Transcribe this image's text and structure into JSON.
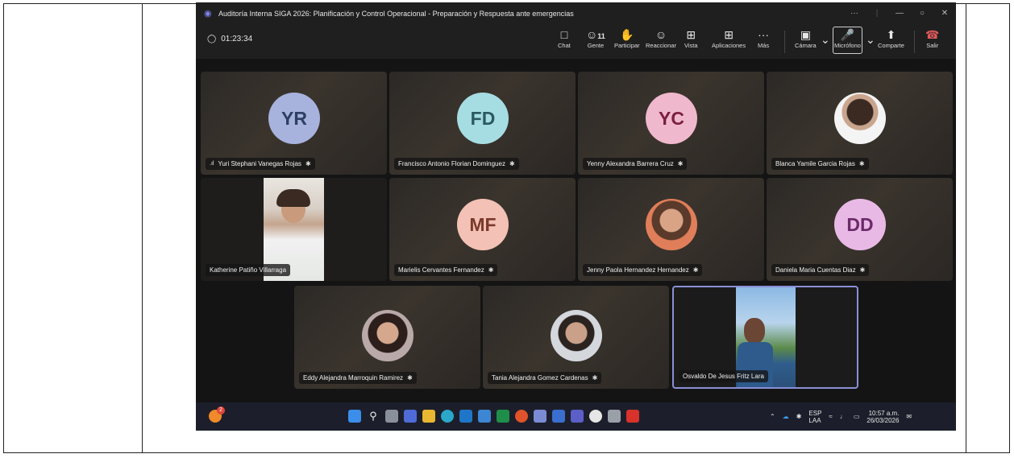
{
  "window": {
    "title": "Auditoría Interna SIGA 2026: Planificación y Control Operacional - Preparación y Respuesta ante emergencias"
  },
  "meeting": {
    "timer": "01:23:34"
  },
  "toolbar": {
    "chat": "Chat",
    "people": "Gente",
    "people_count": "11",
    "raise": "Participar",
    "react": "Reaccionar",
    "view": "Vista",
    "apps": "Aplicaciones",
    "more": "Más",
    "camera": "Cámara",
    "mic": "Micrófono",
    "share": "Comparte",
    "leave": "Salir"
  },
  "participants": [
    {
      "name": "Yuri Stephani Vanegas Rojas",
      "initials": "YR",
      "color": "#2d3e63",
      "bg": "#a7b2dd"
    },
    {
      "name": "Francisco Antonio Florian Dominguez",
      "initials": "FD",
      "color": "#2a5a60",
      "bg": "#a6dde2"
    },
    {
      "name": "Yenny Alexandra Barrera Cruz",
      "initials": "YC",
      "color": "#7a1f3d",
      "bg": "#f0b8cc"
    },
    {
      "name": "Blanca Yamile Garcia Rojas"
    },
    {
      "name": "Katherine Patiño Villarraga"
    },
    {
      "name": "Marielis Cervantes Fernandez",
      "initials": "MF",
      "color": "#7a3a2c",
      "bg": "#f3c1b5"
    },
    {
      "name": "Jenny Paola Hernandez Hernandez"
    },
    {
      "name": "Daniela Maria Cuentas Diaz",
      "initials": "DD",
      "color": "#6b2a6a",
      "bg": "#e9b9e6"
    },
    {
      "name": "Eddy Alejandra Marroquin Ramirez"
    },
    {
      "name": "Tania Alejandra Gomez Cardenas"
    },
    {
      "name": "Osvaldo De Jesus Fritz Lara"
    }
  ],
  "taskbar": {
    "notif_count": "2",
    "lang": "ESP",
    "lang_sub": "LAA",
    "time": "10:57 a.m.",
    "date": "26/03/2026"
  }
}
